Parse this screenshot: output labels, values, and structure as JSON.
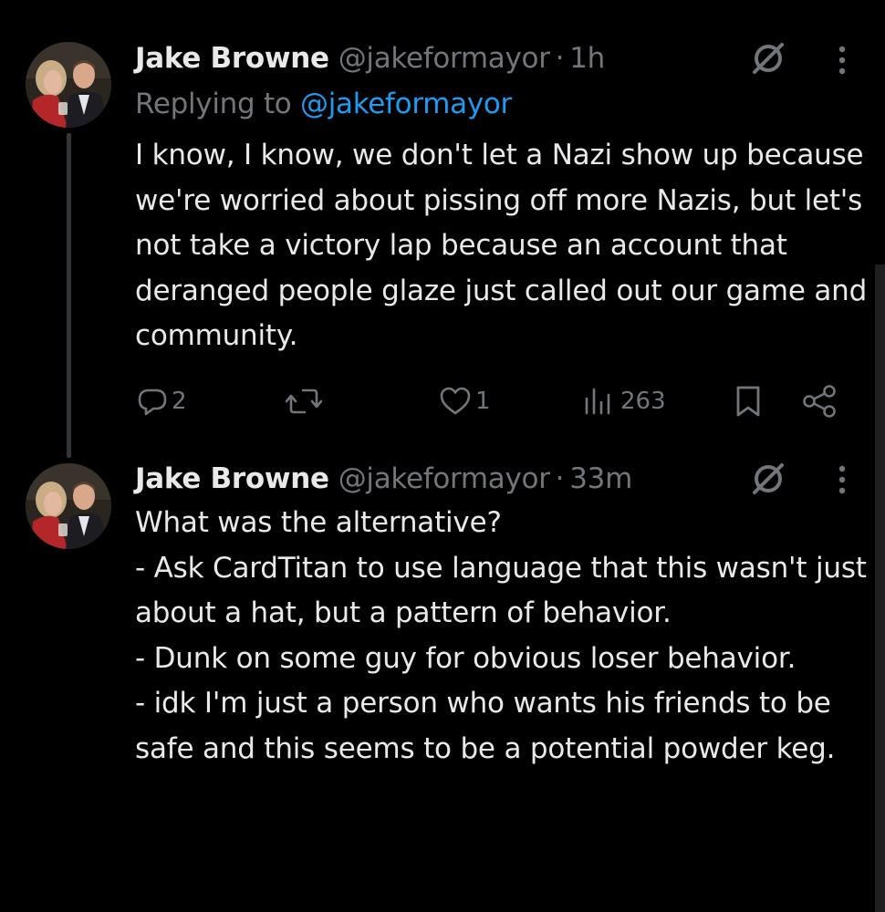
{
  "colors": {
    "background": "#000000",
    "text": "#e7e9ea",
    "secondary": "#71767b",
    "link": "#1d9bf0",
    "thread_line": "#333639"
  },
  "tweets": [
    {
      "author_name": "Jake Browne",
      "handle": "@jakeformayor",
      "separator": "·",
      "time": "1h",
      "replying_prefix": "Replying to ",
      "replying_to": "@jakeformayor",
      "body_lines": [
        "I know, I know, we don't let a Nazi show up because we're worried about pissing off more Nazis, but let's not take a victory lap because an account that deranged people glaze just called out our game and community."
      ],
      "actions": {
        "replies": "2",
        "reposts": "",
        "likes": "1",
        "views": "263"
      },
      "icons": [
        "avatar-photo",
        "grok-icon",
        "more-icon",
        "reply-icon",
        "repost-icon",
        "like-icon",
        "views-icon",
        "bookmark-icon",
        "share-icon"
      ]
    },
    {
      "author_name": "Jake Browne",
      "handle": "@jakeformayor",
      "separator": "·",
      "time": "33m",
      "body_lines": [
        "What was the alternative?",
        "- Ask CardTitan to use language that this wasn't just about a hat, but a pattern of behavior.",
        "- Dunk on some guy for obvious loser behavior.",
        "- idk I'm just a person who wants his friends to be safe and this seems to be a potential powder keg."
      ],
      "icons": [
        "avatar-photo",
        "grok-icon",
        "more-icon"
      ]
    }
  ]
}
